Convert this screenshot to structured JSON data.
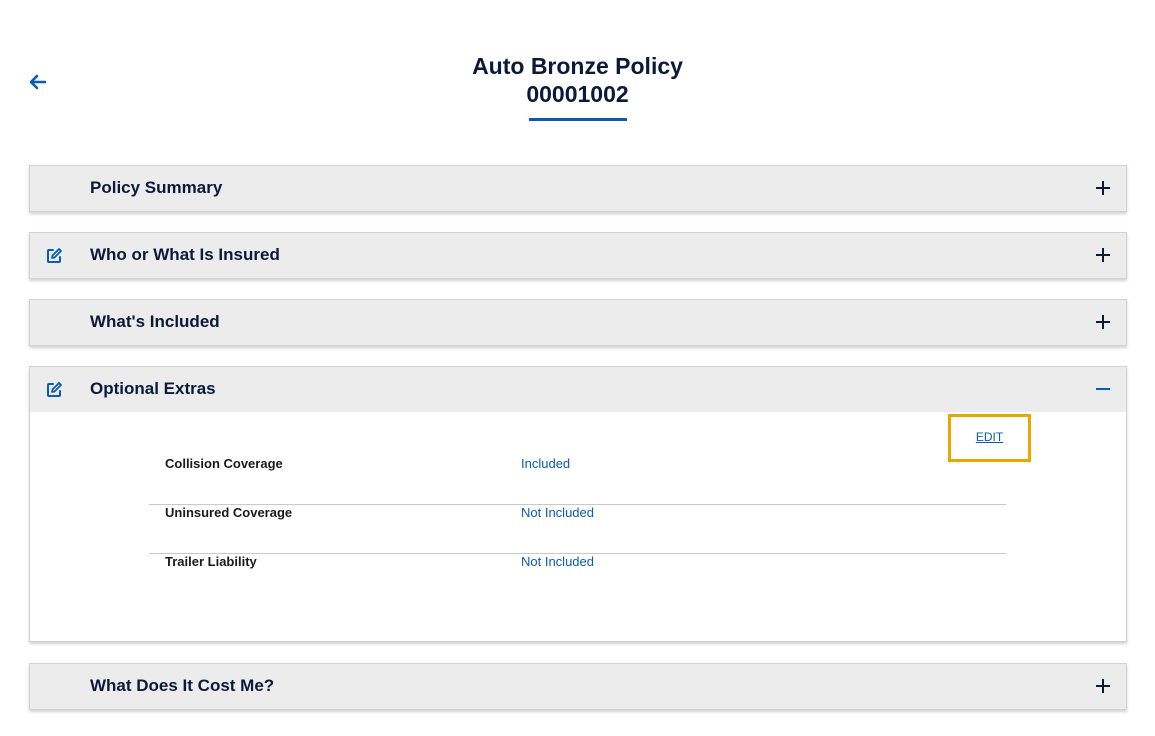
{
  "header": {
    "back_icon": "arrow-left-icon",
    "title_line1": "Auto Bronze Policy",
    "title_line2": "00001002"
  },
  "sections": [
    {
      "title": "Policy Summary",
      "editable": false,
      "expanded": false
    },
    {
      "title": "Who or What Is Insured",
      "editable": true,
      "expanded": false
    },
    {
      "title": "What's Included",
      "editable": false,
      "expanded": false
    },
    {
      "title": "Optional Extras",
      "editable": true,
      "expanded": true
    },
    {
      "title": "What Does It Cost Me?",
      "editable": false,
      "expanded": false
    }
  ],
  "optional_extras": {
    "edit_label": "EDIT",
    "rows": [
      {
        "label": "Collision Coverage",
        "value": "Included"
      },
      {
        "label": "Uninsured Coverage",
        "value": "Not Included"
      },
      {
        "label": "Trailer Liability",
        "value": "Not Included"
      }
    ]
  },
  "colors": {
    "accent": "#0a5bb4",
    "title": "#0b1a3a",
    "header_bg": "#ececec",
    "highlight": "#e8a800"
  }
}
